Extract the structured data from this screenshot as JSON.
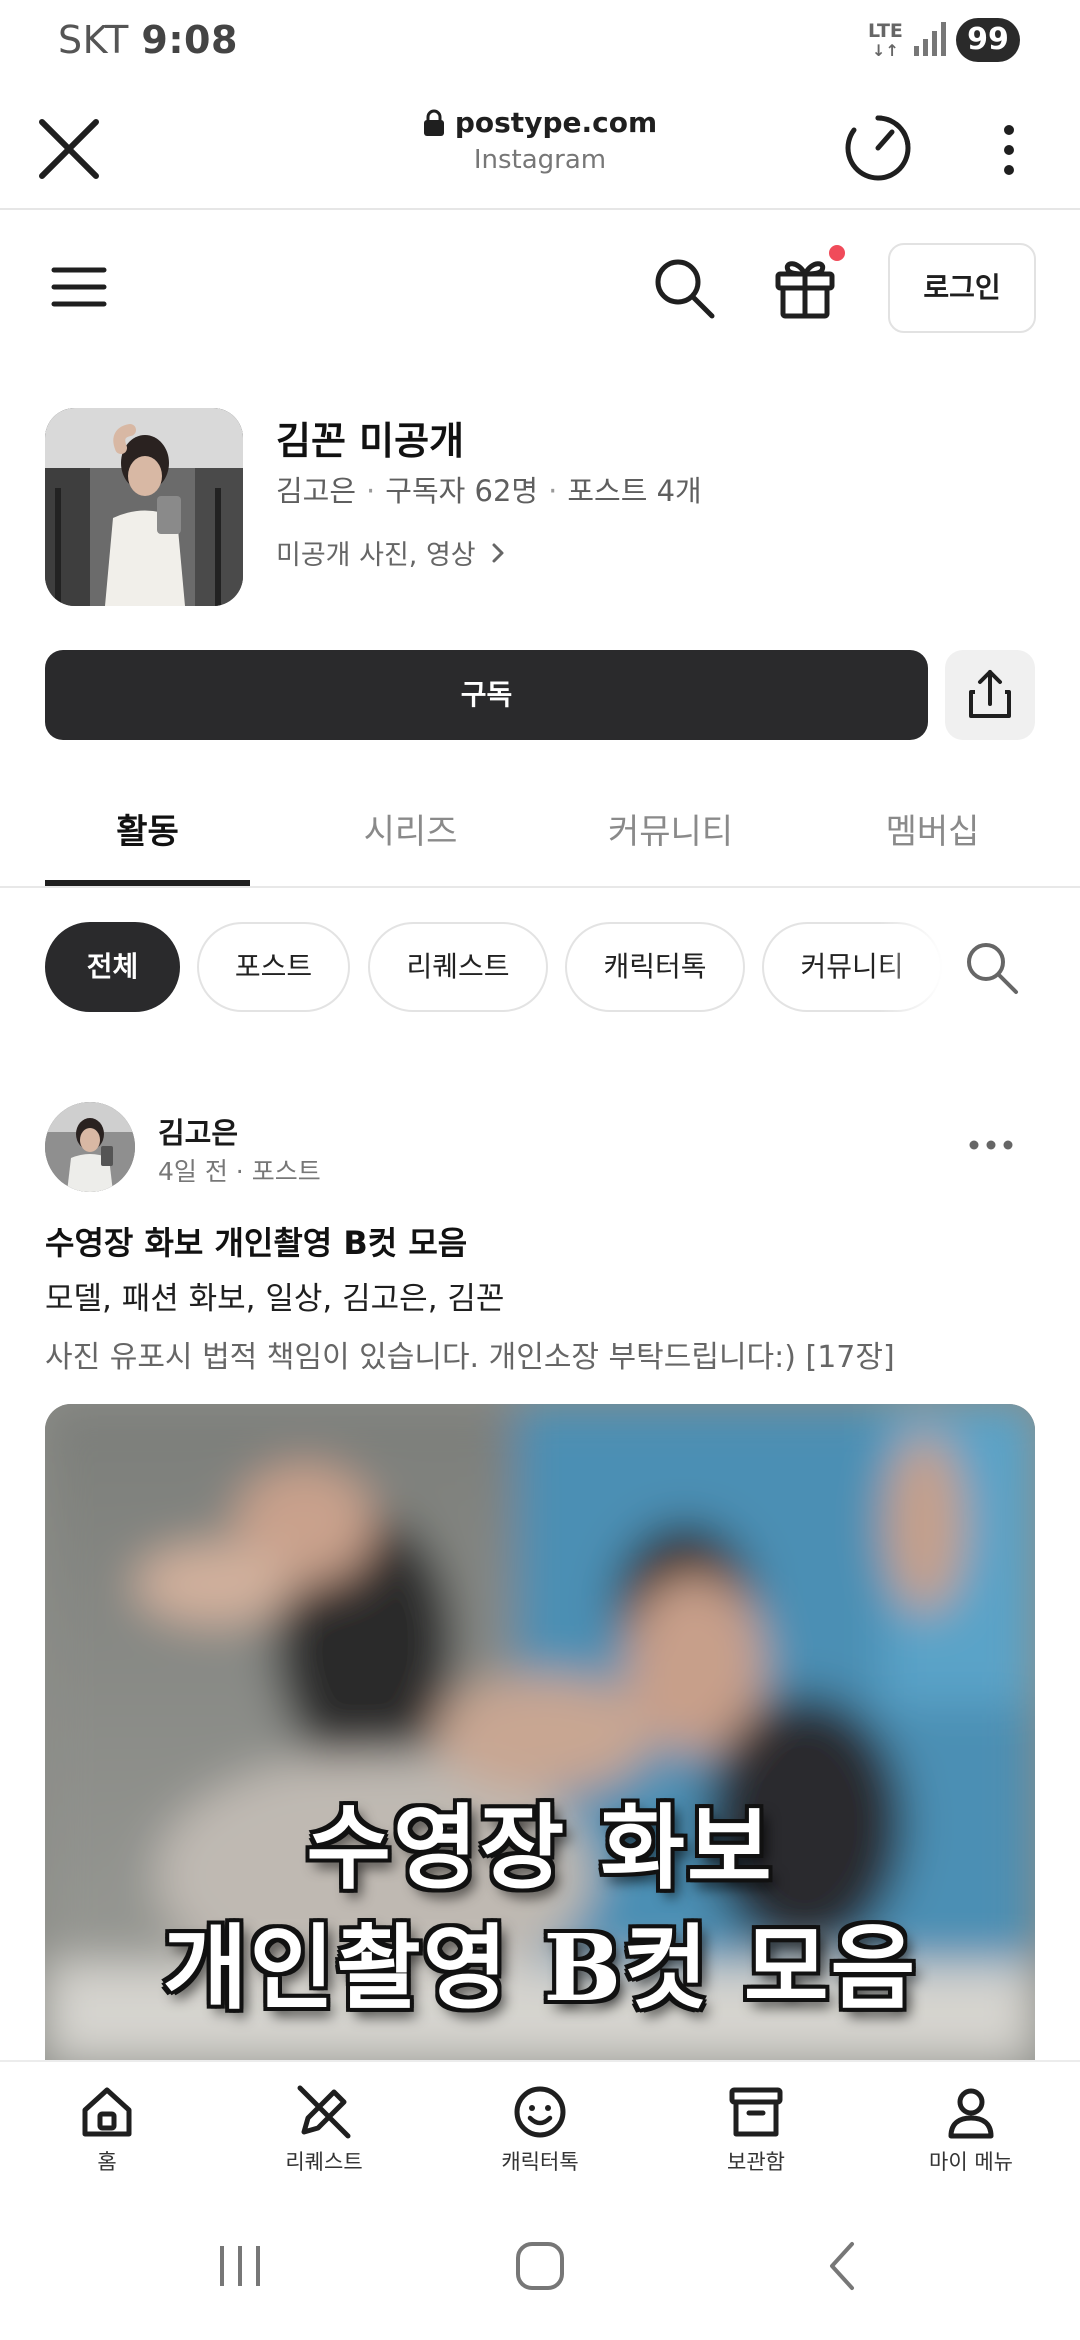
{
  "status_bar": {
    "carrier": "SKT",
    "time": "9:08",
    "network": "LTE",
    "battery": "99"
  },
  "browser": {
    "domain": "postype.com",
    "subtitle": "Instagram"
  },
  "header": {
    "login_label": "로그인"
  },
  "profile": {
    "name": "김꼰 미공개",
    "author": "김고은",
    "subscribers": "구독자 62명",
    "posts": "포스트 4개",
    "description": "미공개 사진, 영상",
    "subscribe_label": "구독"
  },
  "tabs": [
    {
      "label": "활동"
    },
    {
      "label": "시리즈"
    },
    {
      "label": "커뮤니티"
    },
    {
      "label": "멤버십"
    }
  ],
  "chips": [
    {
      "label": "전체"
    },
    {
      "label": "포스트"
    },
    {
      "label": "리퀘스트"
    },
    {
      "label": "캐릭터톡"
    },
    {
      "label": "커뮤니티"
    }
  ],
  "post": {
    "author": "김고은",
    "meta": "4일 전 · 포스트",
    "title": "수영장 화보 개인촬영 B컷 모음",
    "tags": "모델, 패션 화보, 일상, 김고은, 김꼰",
    "description": "사진 유포시 법적 책임이 있습니다. 개인소장 부탁드립니다:) [17장]",
    "image_caption_line1": "수영장 화보",
    "image_caption_line2": "개인촬영 B컷 모음"
  },
  "bottom_nav": [
    {
      "label": "홈",
      "icon": "home-icon"
    },
    {
      "label": "리퀘스트",
      "icon": "pen-icon"
    },
    {
      "label": "캐릭터톡",
      "icon": "smile-icon"
    },
    {
      "label": "보관함",
      "icon": "archive-icon"
    },
    {
      "label": "마이 메뉴",
      "icon": "user-icon"
    }
  ],
  "colors": {
    "primary_dark": "#2a2a2c",
    "notification_dot": "#f04b5a"
  }
}
